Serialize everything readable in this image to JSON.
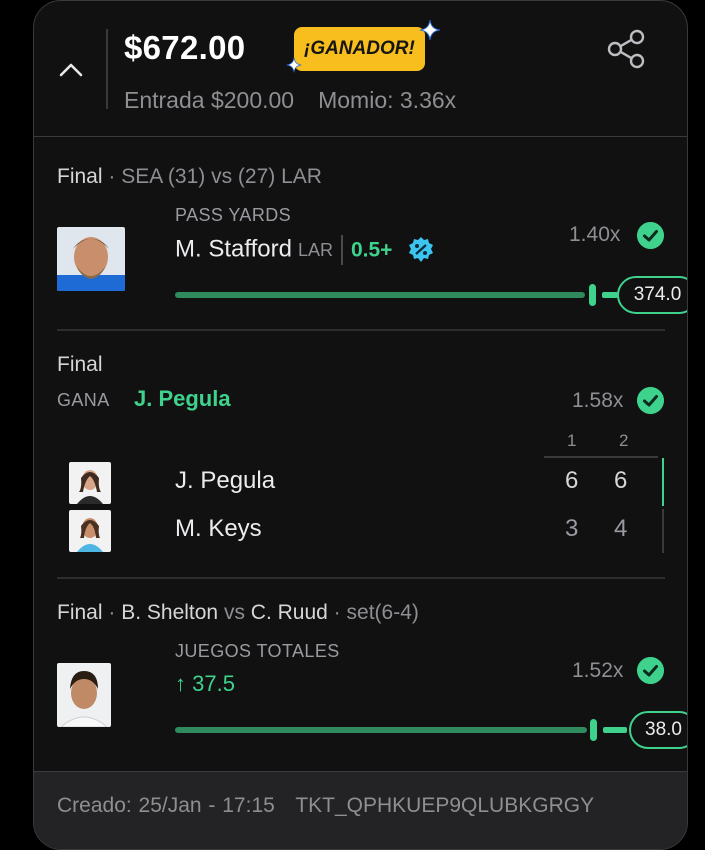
{
  "header": {
    "payout": "$672.00",
    "badge": "¡GANADOR!",
    "entry": "Entrada $200.00",
    "odds": "Momio: 3.36x"
  },
  "legs": [
    {
      "status": "Final",
      "matchup": "SEA (31) vs (27) LAR",
      "market": "PASS YARDS",
      "player": "M. Stafford",
      "team": "LAR",
      "line": "0.5+",
      "multiplier": "1.40x",
      "result": "374.0",
      "progress": 1.0
    },
    {
      "status": "Final",
      "pick_label": "GANA",
      "pick": "J. Pegula",
      "multiplier": "1.58x",
      "set_headers": [
        "1",
        "2"
      ],
      "players": [
        {
          "name": "J. Pegula",
          "scores": [
            "6",
            "6"
          ]
        },
        {
          "name": "M. Keys",
          "scores": [
            "3",
            "4"
          ]
        }
      ]
    },
    {
      "status": "Final",
      "player1": "B. Shelton",
      "vs": "vs",
      "player2": "C. Ruud",
      "set_info": "set(6-4)",
      "market": "JUEGOS TOTALES",
      "line": "↑ 37.5",
      "multiplier": "1.52x",
      "result": "38.0",
      "progress": 1.0
    }
  ],
  "footer": {
    "created": "Creado: 25/Jan - 17:15",
    "ticket": "TKT_QPHKUEP9QLUBKGRGY"
  },
  "colors": {
    "accent": "#3ed28d",
    "badge": "#f8be1d",
    "card": "#111112"
  }
}
